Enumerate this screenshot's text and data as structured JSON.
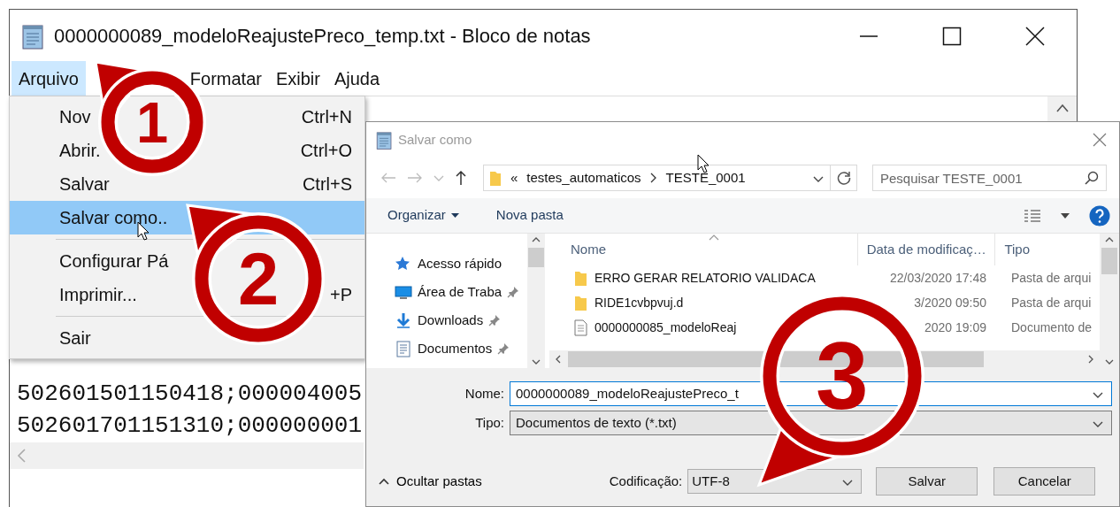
{
  "notepad": {
    "title": "0000000089_modeloReajustePreco_temp.txt - Bloco de notas",
    "menu": [
      {
        "label": "Arquivo",
        "selected": true
      },
      {
        "label": "Formatar",
        "selected": false
      },
      {
        "label": "Exibir",
        "selected": false
      },
      {
        "label": "Ajuda",
        "selected": false
      }
    ],
    "text_lines": [
      "502601501150418;000004005",
      "502601701151310;000000001"
    ],
    "file_menu": [
      {
        "kind": "item",
        "label": "Nov",
        "shortcut": "Ctrl+N",
        "selected": false
      },
      {
        "kind": "item",
        "label": "Abrir.",
        "shortcut": "Ctrl+O",
        "selected": false
      },
      {
        "kind": "item",
        "label": "Salvar",
        "shortcut": "Ctrl+S",
        "selected": false
      },
      {
        "kind": "item",
        "label": "Salvar como..",
        "selected": true
      },
      {
        "kind": "separator"
      },
      {
        "kind": "item",
        "label": "Configurar Pá",
        "selected": false
      },
      {
        "kind": "item",
        "label": "Imprimir...",
        "shortcut": "+P",
        "selected": false
      },
      {
        "kind": "separator"
      },
      {
        "kind": "item",
        "label": "Sair",
        "selected": false
      }
    ]
  },
  "dialog": {
    "title": "Salvar como",
    "address": {
      "overflow": "«",
      "path": [
        "testes_automaticos",
        "TESTE_0001"
      ]
    },
    "search": {
      "placeholder": "Pesquisar TESTE_0001"
    },
    "toolbar": {
      "organize": "Organizar",
      "new_folder": "Nova pasta"
    },
    "nav": [
      {
        "kind": "star",
        "label": "Acesso rápido",
        "pinned": false
      },
      {
        "kind": "desktop",
        "label": "Área de Traba",
        "pinned": true
      },
      {
        "kind": "download",
        "label": "Downloads",
        "pinned": true
      },
      {
        "kind": "documents",
        "label": "Documentos",
        "pinned": true
      }
    ],
    "columns": [
      "Nome",
      "Data de modificaç…",
      "Tipo"
    ],
    "files": [
      {
        "kind": "folder",
        "name": "ERRO GERAR RELATORIO VALIDACA",
        "date": "22/03/2020 17:48",
        "type": "Pasta de arqui"
      },
      {
        "kind": "folder",
        "name": "RIDE1cvbpvuj.d",
        "date": "3/2020 09:50",
        "type": "Pasta de arqui"
      },
      {
        "kind": "document",
        "name": "0000000085_modeloReaj",
        "date": "2020 19:09",
        "type": "Documento de"
      }
    ],
    "fields": [
      {
        "label": "Nome:",
        "value": "0000000089_modeloReajustePreco_t",
        "kind": "combo"
      },
      {
        "label": "Tipo:",
        "value": "Documentos de texto (*.txt)",
        "kind": "select"
      }
    ],
    "hide_folders": "Ocultar pastas",
    "encoding": {
      "label": "Codificação:",
      "value": "UTF-8"
    },
    "buttons": [
      "Salvar",
      "Cancelar"
    ]
  },
  "callouts": [
    {
      "number": "1"
    },
    {
      "number": "2"
    },
    {
      "number": "3"
    }
  ]
}
